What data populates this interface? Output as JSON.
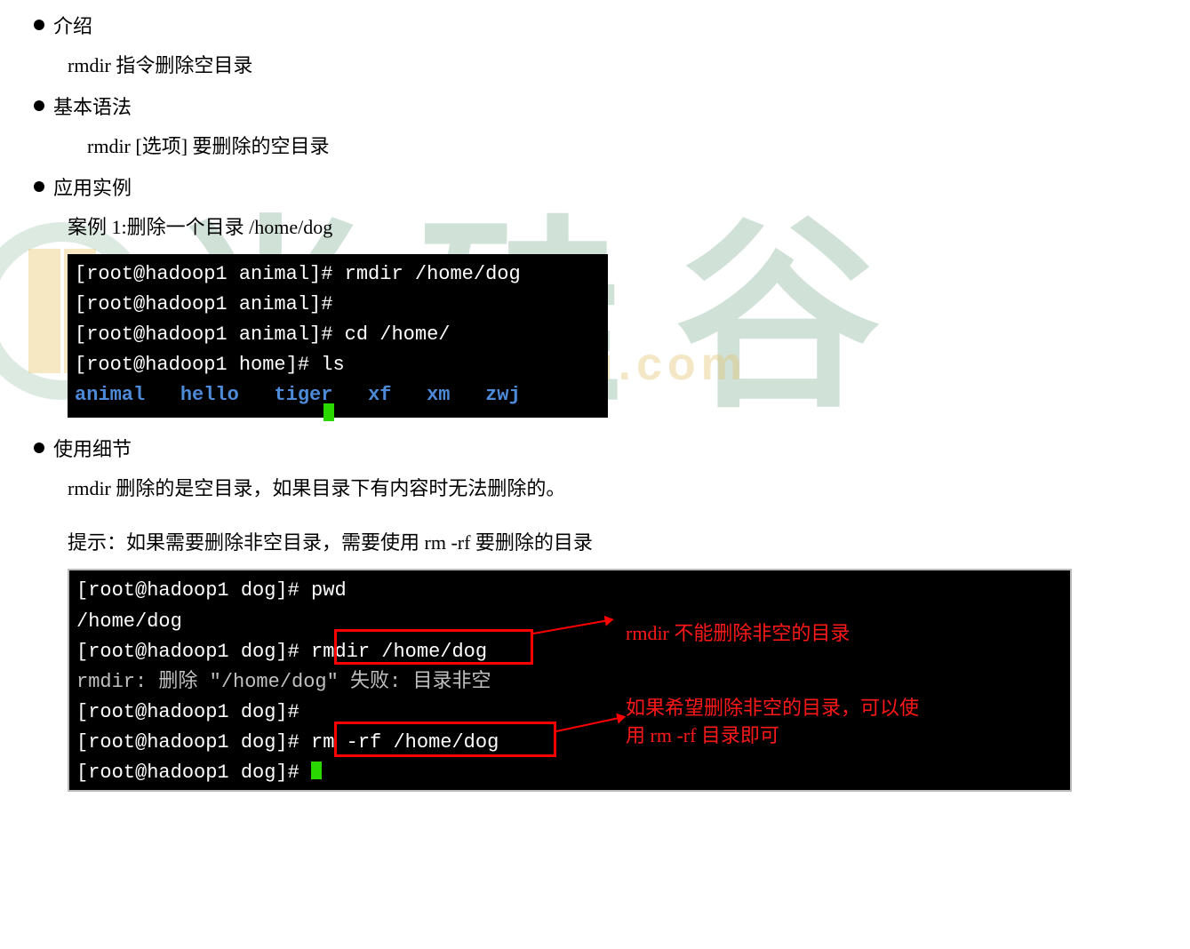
{
  "sections": {
    "intro": {
      "title": "介绍",
      "body": "rmdir 指令删除空目录"
    },
    "syntax": {
      "title": "基本语法",
      "body": "rmdir   [选项]   要删除的空目录"
    },
    "example": {
      "title": "应用实例",
      "case": "案例 1:删除一个目录  /home/dog"
    },
    "details": {
      "title": "使用细节",
      "line1": "rmdir 删除的是空目录，如果目录下有内容时无法删除的。",
      "line2": "提示：如果需要删除非空目录，需要使用   rm -rf 要删除的目录"
    }
  },
  "terminal1": {
    "l1_prompt": "[root@hadoop1 animal]#",
    "l1_cmd": " rmdir /home/dog",
    "l2_prompt": "[root@hadoop1 animal]#",
    "l3_prompt": "[root@hadoop1 animal]#",
    "l3_cmd": " cd /home/",
    "l4_prompt": "[root@hadoop1 home]#",
    "l4_cmd": " ls",
    "ls_items": [
      "animal",
      "hello",
      "tiger",
      "xf",
      "xm",
      "zwj"
    ]
  },
  "terminal2": {
    "l1_prompt": "[root@hadoop1 dog]#",
    "l1_cmd": " pwd",
    "l2": "/home/dog",
    "l3_prompt": "[root@hadoop1 dog]#",
    "l3_cmd": " rmdir /home/dog",
    "l4": "rmdir: 删除 \"/home/dog\" 失败: 目录非空",
    "l5_prompt": "[root@hadoop1 dog]#",
    "l6_prompt": "[root@hadoop1 dog]#",
    "l6_cmd": " rm -rf /home/dog",
    "l7_prompt": "[root@hadoop1 dog]#"
  },
  "annotations": {
    "a1": "rmdir 不能删除非空的目录",
    "a2": "如果希望删除非空的目录，可以使用 rm -rf 目录即可"
  },
  "watermark_url": "gu.com"
}
